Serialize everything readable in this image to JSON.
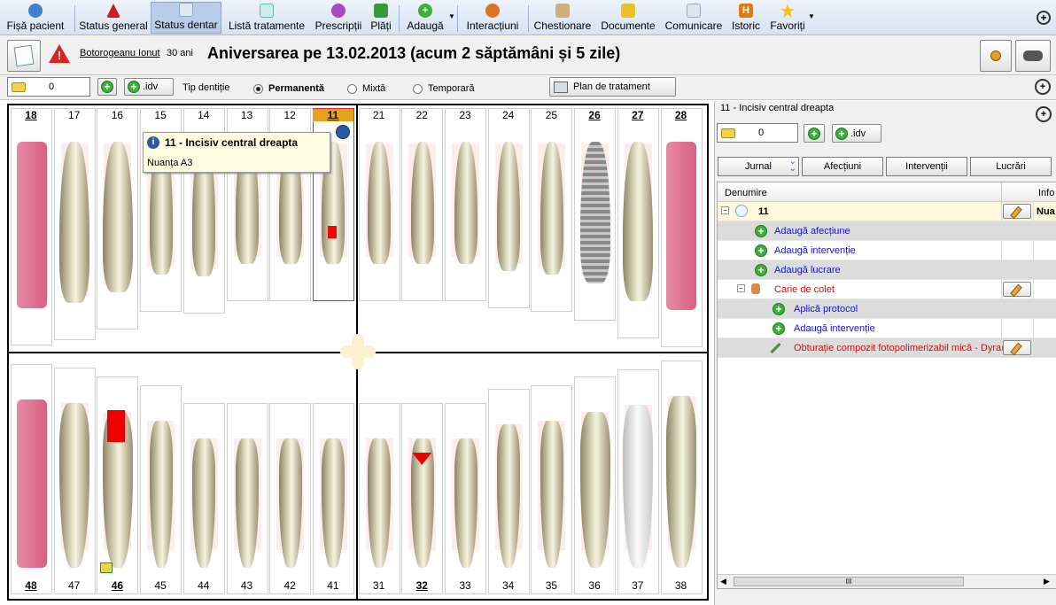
{
  "toolbar": {
    "items": [
      {
        "label": "Fișă pacient",
        "icon": "person-icon",
        "color": "#3f7fcf"
      },
      {
        "label": "Status general",
        "icon": "warning-icon",
        "color": "#cc2020"
      },
      {
        "label": "Status dentar",
        "icon": "tooth-icon",
        "color": "#8aa8c8"
      },
      {
        "label": "Listă tratamente",
        "icon": "tooth-list-icon",
        "color": "#5cb8b2"
      },
      {
        "label": "Prescripții",
        "icon": "pill-icon",
        "color": "#a64ac9"
      },
      {
        "label": "Plăți",
        "icon": "money-icon",
        "color": "#3a9a3a"
      },
      {
        "label": "Adaugă",
        "icon": "add-icon",
        "color": "#3fae3a"
      },
      {
        "label": "Interacțiuni",
        "icon": "people-icon",
        "color": "#d9742a"
      },
      {
        "label": "Chestionare",
        "icon": "questionnaire-icon",
        "color": "#c9b27a"
      },
      {
        "label": "Documente",
        "icon": "folder-icon",
        "color": "#e8c02a"
      },
      {
        "label": "Comunicare",
        "icon": "envelope-icon",
        "color": "#9aa9bf"
      },
      {
        "label": "Istoric",
        "icon": "history-icon",
        "color": "#e07b10"
      },
      {
        "label": "Favoriți",
        "icon": "star-icon",
        "color": "#f2c21a"
      }
    ]
  },
  "header": {
    "patient_name": "Botorogeanu Ionut",
    "age": "30 ani",
    "anniversary": "Aniversarea pe 13.02.2013 (acum 2 săptămâni și 5 zile)"
  },
  "row3": {
    "count": "0",
    "idv_label": ".idv",
    "dentition_label": "Tip dentiție",
    "options": [
      "Permanentă",
      "Mixtă",
      "Temporară"
    ],
    "selected": "Permanentă",
    "plan_button": "Plan de tratament"
  },
  "chart": {
    "upper_teeth": [
      "18",
      "17",
      "16",
      "15",
      "14",
      "13",
      "12",
      "11",
      "21",
      "22",
      "23",
      "24",
      "25",
      "26",
      "27",
      "28"
    ],
    "lower_teeth": [
      "48",
      "47",
      "46",
      "45",
      "44",
      "43",
      "42",
      "41",
      "31",
      "32",
      "33",
      "34",
      "35",
      "36",
      "37",
      "38"
    ],
    "selected_tooth": "11",
    "tooltip_title": "11 - Incisiv central dreapta",
    "tooltip_body": "Nuanța A3",
    "accent": "#e4a11b"
  },
  "panel": {
    "title": "11 - Incisiv central dreapta",
    "count": "0",
    "idv_label": ".idv",
    "tabs": [
      "Jurnal",
      "Afecțiuni",
      "Intervenții",
      "Lucrări"
    ],
    "columns": [
      "Denumire",
      "Info"
    ],
    "rows": [
      {
        "label": "11",
        "info": "Nua"
      },
      {
        "label": "Adaugă afecțiune"
      },
      {
        "label": "Adaugă intervenție"
      },
      {
        "label": "Adaugă lucrare"
      },
      {
        "label": "Carie de colet"
      },
      {
        "label": "Aplică protocol"
      },
      {
        "label": "Adaugă intervenție"
      },
      {
        "label": "Obturație compozit fotopolimerizabil mică - Dyract"
      }
    ],
    "scroll_label": "III"
  }
}
